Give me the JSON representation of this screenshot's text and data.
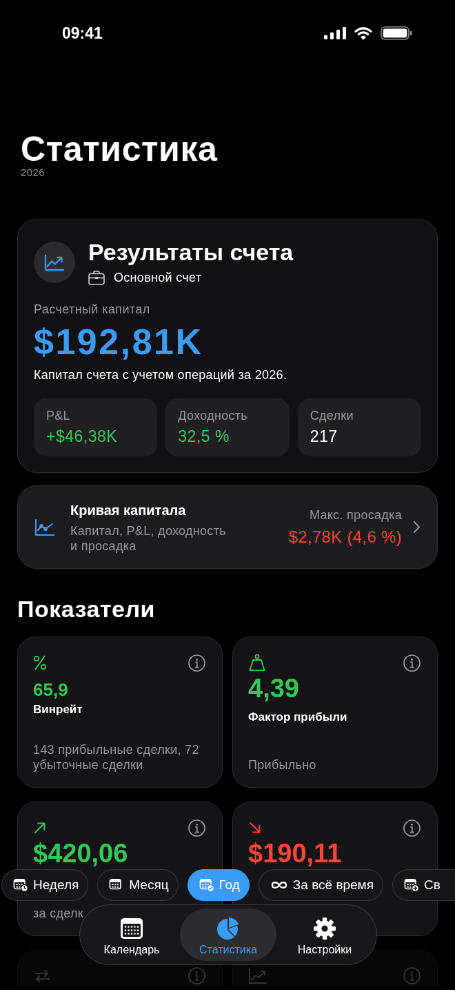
{
  "status_bar": {
    "time": "09:41"
  },
  "header": {
    "title": "Статистика",
    "subtitle": "2026"
  },
  "account_card": {
    "title": "Результаты счета",
    "account": "Основной счет",
    "capital_label": "Расчетный капитал",
    "capital_value": "$192,81K",
    "caption": "Капитал счета с учетом операций за 2026.",
    "stats": [
      {
        "label": "P&L",
        "value": "+$46,38K",
        "color": "#34c759"
      },
      {
        "label": "Доходность",
        "value": "32,5 %",
        "color": "#34c759"
      },
      {
        "label": "Сделки",
        "value": "217",
        "color": "#ffffff"
      }
    ]
  },
  "equity_curve": {
    "title": "Кривая капитала",
    "subtitle": "Капитал, P&L, доходность и просадка",
    "drawdown_label": "Макс. просадка",
    "drawdown_value": "$2,78K (4,6 %)"
  },
  "metrics": {
    "title": "Показатели",
    "cards": [
      {
        "kind": "percent",
        "color": "#34c759",
        "value": "65,9",
        "label": "Винрейт",
        "note": "143 прибыльные сделки, 72 убыточные сделки"
      },
      {
        "kind": "weight",
        "color": "#34c759",
        "value": "4,39",
        "label": "Фактор прибыли",
        "note": "Прибыльно"
      },
      {
        "kind": "up",
        "color": "#34c759",
        "value": "$420,06",
        "note": "за сделк"
      },
      {
        "kind": "down",
        "color": "#ff453a",
        "value": "$190,11"
      },
      {
        "kind": "swap"
      },
      {
        "kind": "chart"
      }
    ]
  },
  "period_filter": [
    {
      "kind": "week",
      "label": "Неделя",
      "selected": false
    },
    {
      "kind": "month",
      "label": "Месяц",
      "selected": false
    },
    {
      "kind": "year",
      "label": "Год",
      "selected": true
    },
    {
      "kind": "all",
      "label": "За всё время",
      "selected": false
    },
    {
      "kind": "custom",
      "label": "Св",
      "selected": false
    }
  ],
  "tab_bar": [
    {
      "kind": "calendar",
      "label": "Календарь",
      "selected": false
    },
    {
      "kind": "stats",
      "label": "Статистика",
      "selected": true
    },
    {
      "kind": "settings",
      "label": "Настройки",
      "selected": false
    }
  ]
}
